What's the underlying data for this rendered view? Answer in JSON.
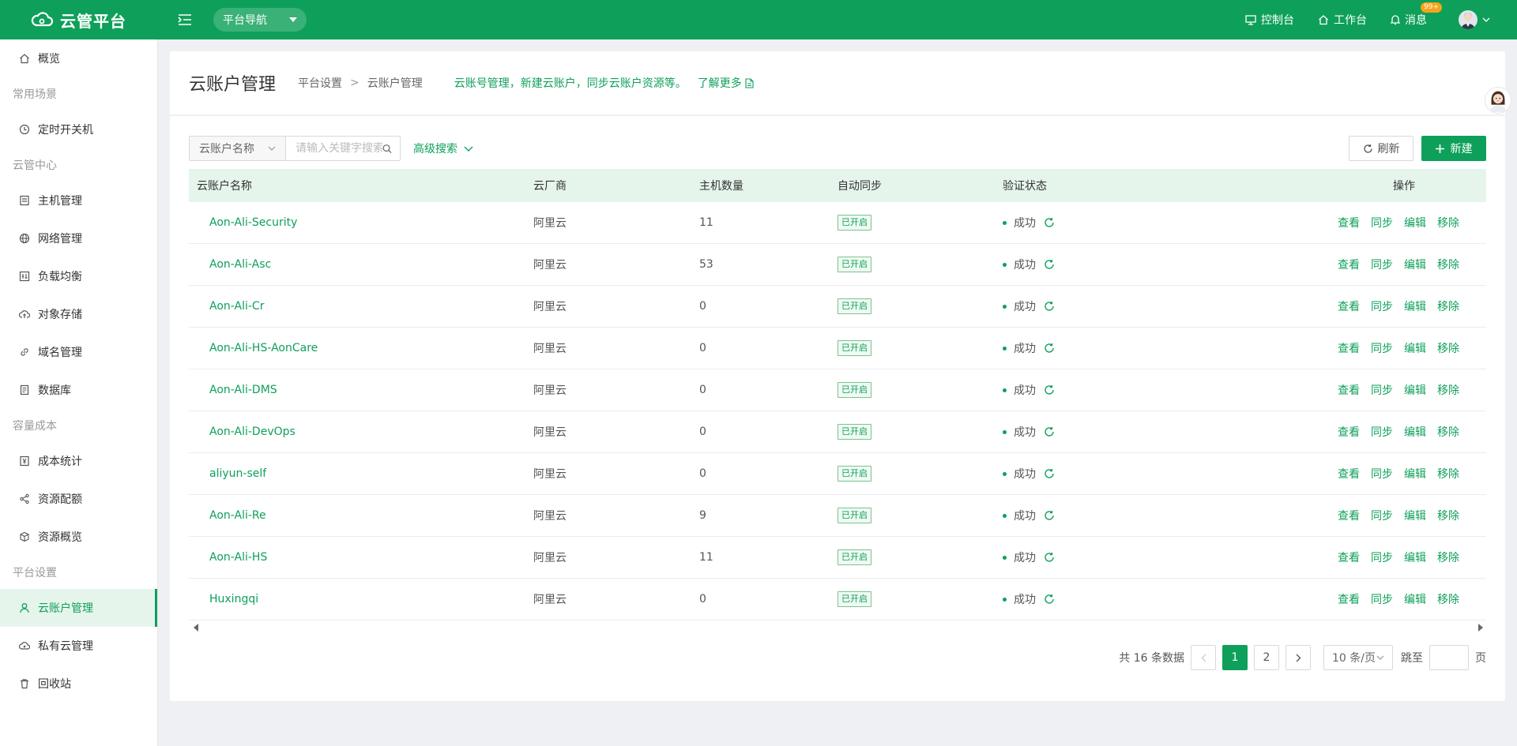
{
  "app": {
    "name": "云管平台",
    "nav_label": "平台导航"
  },
  "topbar": {
    "console_label": "控制台",
    "workbench_label": "工作台",
    "messages_label": "消息",
    "messages_badge": "99+"
  },
  "sidebar": {
    "overview": "概览",
    "group_common": "常用场景",
    "timer": "定时开关机",
    "group_cloud": "云管中心",
    "hosts": "主机管理",
    "network": "网络管理",
    "lb": "负载均衡",
    "oss": "对象存储",
    "domain": "域名管理",
    "db": "数据库",
    "group_cost": "容量成本",
    "cost_stats": "成本统计",
    "quota": "资源配额",
    "res_overview": "资源概览",
    "group_platform": "平台设置",
    "cloud_accounts": "云账户管理",
    "private_cloud": "私有云管理",
    "recycle": "回收站"
  },
  "header": {
    "title": "云账户管理",
    "breadcrumb": [
      "平台设置",
      "云账户管理"
    ],
    "breadcrumb_sep": ">",
    "desc": "云账号管理，新建云账户，同步云账户资源等。",
    "learn_more": "了解更多"
  },
  "toolbar": {
    "search_field": "云账户名称",
    "search_placeholder": "请输入关键字搜索",
    "advanced_search": "高级搜索",
    "refresh_label": "刷新",
    "new_label": "新建"
  },
  "table": {
    "headers": [
      "云账户名称",
      "云厂商",
      "主机数量",
      "自动同步",
      "验证状态",
      "操作"
    ],
    "rows": [
      {
        "name": "Aon-Ali-Security",
        "vendor": "阿里云",
        "hosts": "11",
        "sync": "已开启",
        "status": "成功"
      },
      {
        "name": "Aon-Ali-Asc",
        "vendor": "阿里云",
        "hosts": "53",
        "sync": "已开启",
        "status": "成功"
      },
      {
        "name": "Aon-Ali-Cr",
        "vendor": "阿里云",
        "hosts": "0",
        "sync": "已开启",
        "status": "成功"
      },
      {
        "name": "Aon-Ali-HS-AonCare",
        "vendor": "阿里云",
        "hosts": "0",
        "sync": "已开启",
        "status": "成功"
      },
      {
        "name": "Aon-Ali-DMS",
        "vendor": "阿里云",
        "hosts": "0",
        "sync": "已开启",
        "status": "成功"
      },
      {
        "name": "Aon-Ali-DevOps",
        "vendor": "阿里云",
        "hosts": "0",
        "sync": "已开启",
        "status": "成功"
      },
      {
        "name": "aliyun-self",
        "vendor": "阿里云",
        "hosts": "0",
        "sync": "已开启",
        "status": "成功"
      },
      {
        "name": "Aon-Ali-Re",
        "vendor": "阿里云",
        "hosts": "9",
        "sync": "已开启",
        "status": "成功"
      },
      {
        "name": "Aon-Ali-HS",
        "vendor": "阿里云",
        "hosts": "11",
        "sync": "已开启",
        "status": "成功"
      },
      {
        "name": "Huxingqi",
        "vendor": "阿里云",
        "hosts": "0",
        "sync": "已开启",
        "status": "成功"
      }
    ],
    "ops": [
      "查看",
      "同步",
      "编辑",
      "移除"
    ]
  },
  "pagination": {
    "total_text": "共 16 条数据",
    "pages": [
      "1",
      "2"
    ],
    "current": "1",
    "page_size": "10 条/页",
    "jump_label": "跳至",
    "page_unit": "页"
  },
  "colors": {
    "primary": "#0ea05a",
    "header_bg": "#e6f5ec"
  }
}
